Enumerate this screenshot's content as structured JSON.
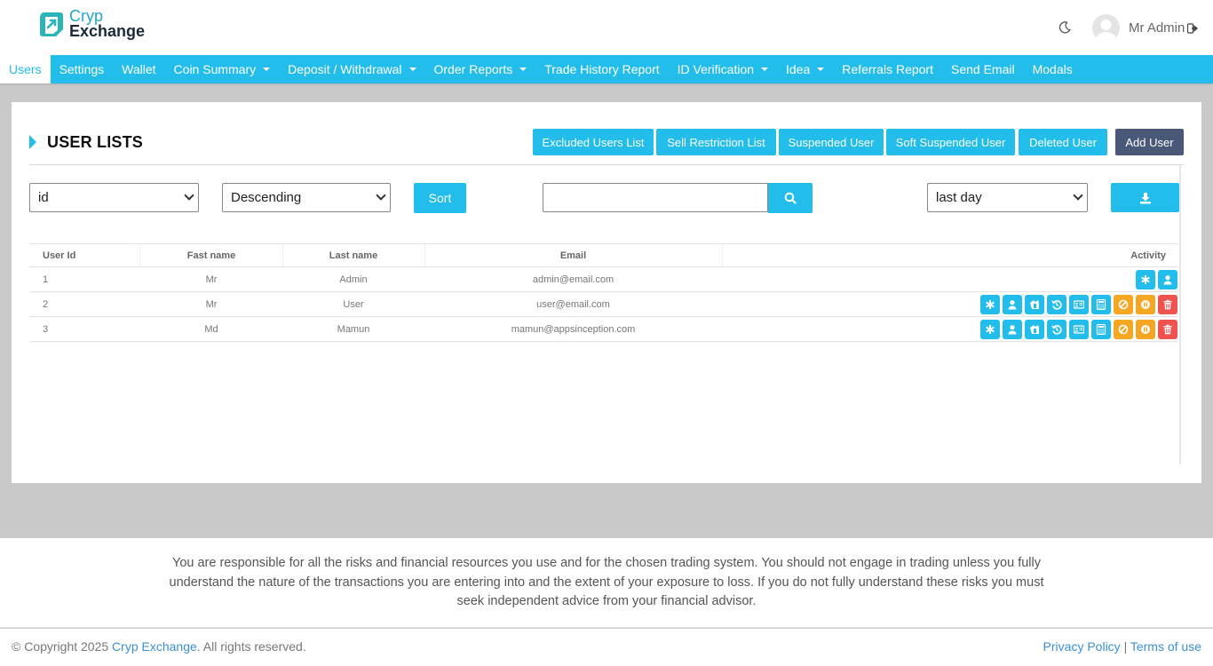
{
  "brand": {
    "line1": "Cryp",
    "line2": "Exchange"
  },
  "header": {
    "user_name": "Mr Admin"
  },
  "nav": [
    {
      "label": "Users",
      "active": true
    },
    {
      "label": "Settings"
    },
    {
      "label": "Wallet"
    },
    {
      "label": "Coin Summary",
      "dropdown": true
    },
    {
      "label": "Deposit / Withdrawal",
      "dropdown": true
    },
    {
      "label": "Order Reports",
      "dropdown": true
    },
    {
      "label": "Trade History Report"
    },
    {
      "label": "ID Verification",
      "dropdown": true
    },
    {
      "label": "Idea",
      "dropdown": true
    },
    {
      "label": "Referrals Report"
    },
    {
      "label": "Send Email"
    },
    {
      "label": "Modals"
    }
  ],
  "page": {
    "title": "USER LISTS",
    "buttons": {
      "excluded": "Excluded Users List",
      "sell_restriction": "Sell Restriction List",
      "suspended": "Suspended User",
      "soft_suspended": "Soft Suspended User",
      "deleted": "Deleted User",
      "add_user": "Add User"
    }
  },
  "filters": {
    "sort_field": "id",
    "sort_order": "Descending",
    "sort_label": "Sort",
    "search_value": "",
    "range": "last day"
  },
  "table": {
    "headers": {
      "id": "User Id",
      "first": "Fast name",
      "last": "Last name",
      "email": "Email",
      "activity": "Activity"
    },
    "rows": [
      {
        "id": "1",
        "first": "Mr",
        "last": "Admin",
        "email": "admin@email.com"
      },
      {
        "id": "2",
        "first": "Mr",
        "last": "User",
        "email": "user@email.com"
      },
      {
        "id": "3",
        "first": "Md",
        "last": "Mamun",
        "email": "mamun@appsinception.com"
      }
    ]
  },
  "footer": {
    "disclaimer": "You are responsible for all the risks and financial resources you use and for the chosen trading system. You should not engage in trading unless you fully understand the nature of the transactions you are entering into and the extent of your exposure to loss. If you do not fully understand these risks you must seek independent advice from your financial advisor.",
    "copyright_prefix": "© Copyright 2025 ",
    "copyright_brand": "Cryp Exchange",
    "copyright_suffix": ". All rights reserved.",
    "privacy": "Privacy Policy",
    "separator": "|",
    "terms": "Terms of use"
  },
  "colors": {
    "accent": "#22bdea",
    "dark_button": "#4a5878",
    "warning": "#f5a623",
    "danger": "#ef5350"
  }
}
